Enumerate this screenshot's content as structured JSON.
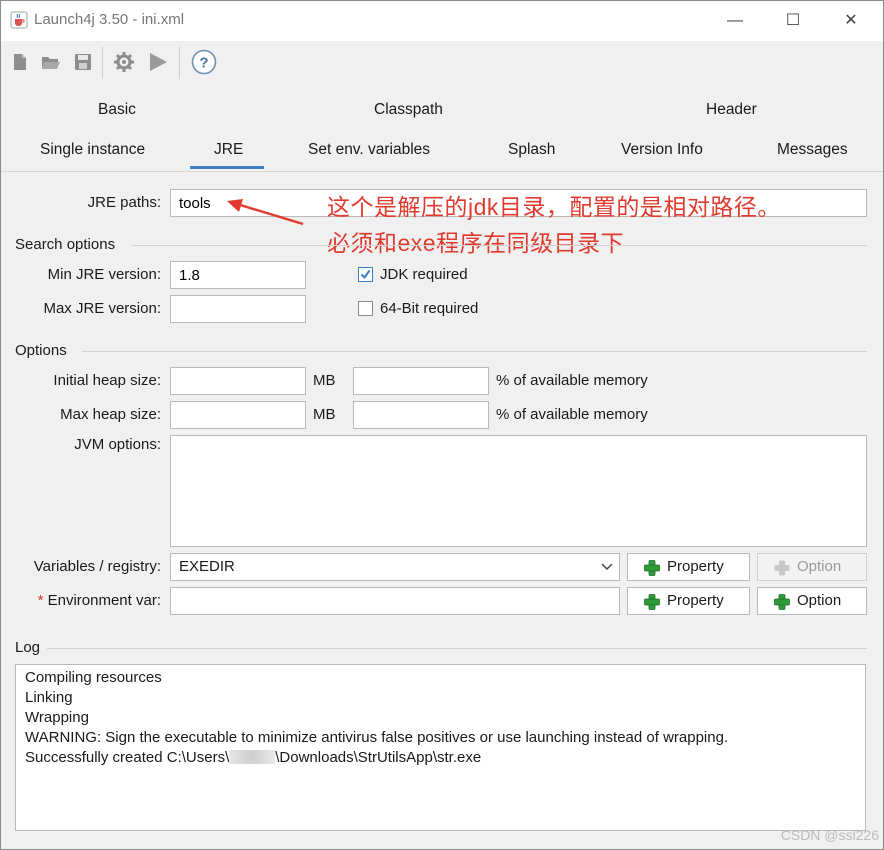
{
  "window": {
    "title": "Launch4j 3.50 - ini.xml",
    "minimize": "—",
    "maximize": "☐",
    "close": "✕"
  },
  "toolbar": {
    "icons": [
      "new-file-icon",
      "open-folder-icon",
      "save-icon",
      "build-gear-icon",
      "run-play-icon",
      "help-icon"
    ]
  },
  "tabs": {
    "row1": [
      "Basic",
      "Classpath",
      "Header"
    ],
    "row2": [
      "Single instance",
      "JRE",
      "Set env. variables",
      "Splash",
      "Version Info",
      "Messages"
    ],
    "active": "JRE"
  },
  "jre": {
    "paths_label": "JRE paths:",
    "paths_value": "tools",
    "annotation_line1": "这个是解压的jdk目录，配置的是相对路径。",
    "annotation_line2": "必须和exe程序在同级目录下"
  },
  "search": {
    "title": "Search options",
    "min_label": "Min JRE version:",
    "min_value": "1.8",
    "max_label": "Max JRE version:",
    "max_value": "",
    "jdk_required_label": "JDK required",
    "jdk_required": true,
    "bit64_label": "64-Bit required",
    "bit64": false
  },
  "options": {
    "title": "Options",
    "initial_heap_label": "Initial heap size:",
    "max_heap_label": "Max heap size:",
    "mb": "MB",
    "percent_label": "% of available memory",
    "jvm_label": "JVM options:",
    "vars_label": "Variables / registry:",
    "vars_value": "EXEDIR",
    "env_required_mark": "*",
    "env_label": "Environment var:",
    "property_label": "Property",
    "option_label": "Option"
  },
  "log": {
    "title": "Log",
    "lines": [
      "Compiling resources",
      "Linking",
      "Wrapping",
      "WARNING: Sign the executable to minimize antivirus false positives or use launching instead of wrapping.",
      "Successfully created C:\\Users\\",
      "\\Downloads\\StrUtilsApp\\str.exe"
    ]
  },
  "watermark": "CSDN @ssl226",
  "colors": {
    "accent": "#3c7fc3",
    "annotation": "#e03a2e",
    "plus_green": "#2e9b3a"
  }
}
